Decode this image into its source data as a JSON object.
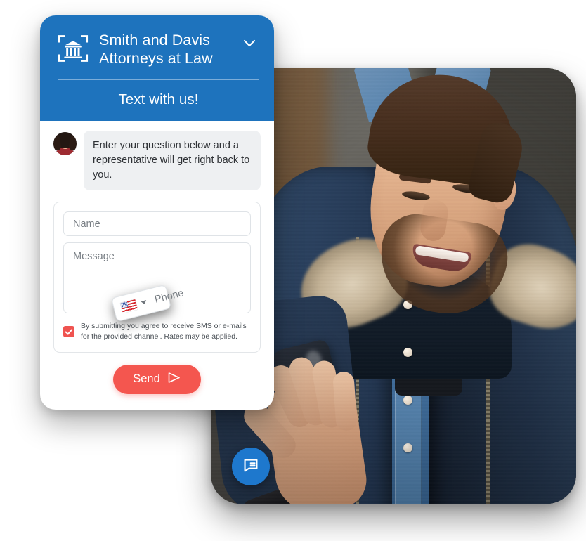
{
  "widget": {
    "header": {
      "logo_icon": "courthouse-column-icon",
      "brand_name": "Smith and Davis Attorneys at Law",
      "brand_line_1": "Smith and Davis",
      "brand_line_2": "Attorneys at Law",
      "collapse_icon": "chevron-down-icon",
      "tagline": "Text with us!",
      "background_color": "#1e73bd"
    },
    "conversation": {
      "agent_avatar": "agent-avatar-photo",
      "messages": [
        {
          "sender": "agent",
          "text": "Enter your question below and a representative will get right back to you."
        }
      ]
    },
    "form": {
      "name_field": {
        "placeholder": "Name",
        "value": ""
      },
      "phone_field": {
        "placeholder": "Phone",
        "value": "",
        "country_flag": "us-flag-icon",
        "country_code_caret": "caret-down-icon"
      },
      "message_field": {
        "placeholder": "Message",
        "value": ""
      },
      "consent": {
        "checked": true,
        "checkbox_color": "#ef5350",
        "text": "By submitting you agree to receive SMS or e-mails for the provided channel. Rates may be applied."
      },
      "submit": {
        "label": "Send",
        "icon": "send-paper-plane-icon",
        "color": "#f4564f"
      }
    }
  },
  "launcher": {
    "icon": "chat-bubble-icon",
    "color": "#1e78cd"
  },
  "photo": {
    "alt": "young-man-smiling-at-smartphone-outdoors",
    "subject": "man in denim shirt and navy fur-hooded parka looking at phone"
  }
}
